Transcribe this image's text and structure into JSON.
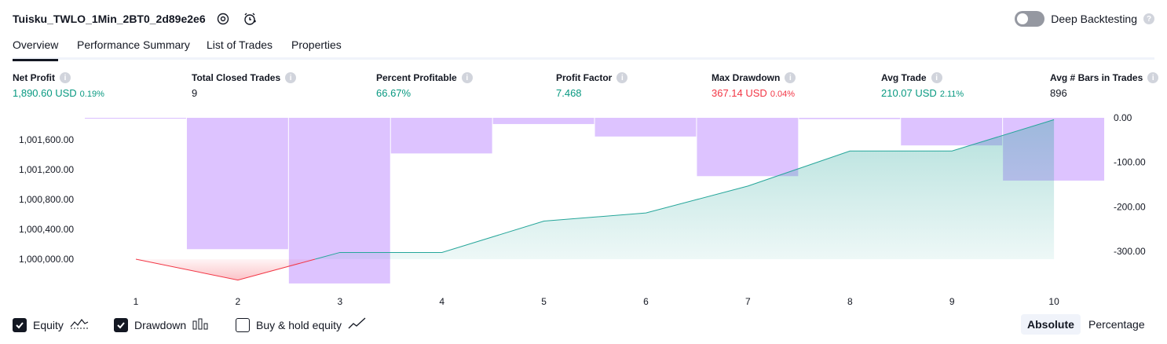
{
  "header": {
    "title": "Tuisku_TWLO_1Min_2BT0_2d89e2e6",
    "deep_backtesting_label": "Deep Backtesting",
    "help_glyph": "?"
  },
  "tabs": [
    {
      "label": "Overview",
      "active": true
    },
    {
      "label": "Performance Summary",
      "active": false
    },
    {
      "label": "List of Trades",
      "active": false
    },
    {
      "label": "Properties",
      "active": false
    }
  ],
  "stats": [
    {
      "label": "Net Profit",
      "value": "1,890.60 USD",
      "pct": "0.19%",
      "color": "green"
    },
    {
      "label": "Total Closed Trades",
      "value": "9",
      "pct": "",
      "color": "default"
    },
    {
      "label": "Percent Profitable",
      "value": "66.67%",
      "pct": "",
      "color": "green"
    },
    {
      "label": "Profit Factor",
      "value": "7.468",
      "pct": "",
      "color": "green"
    },
    {
      "label": "Max Drawdown",
      "value": "367.14 USD",
      "pct": "0.04%",
      "color": "red"
    },
    {
      "label": "Avg Trade",
      "value": "210.07 USD",
      "pct": "2.11%",
      "color": "green"
    },
    {
      "label": "Avg # Bars in Trades",
      "value": "896",
      "pct": "",
      "color": "default"
    }
  ],
  "chart_data": {
    "type": "bar+line",
    "x": [
      1,
      2,
      3,
      4,
      5,
      6,
      7,
      8,
      9,
      10
    ],
    "left_axis": {
      "ticks": [
        "1,001,600.00",
        "1,001,200.00",
        "1,000,800.00",
        "1,000,400.00",
        "1,000,000.00"
      ],
      "tick_values": [
        1001600,
        1001200,
        1000800,
        1000400,
        1000000
      ]
    },
    "right_axis": {
      "ticks": [
        "0.00",
        "-100.00",
        "-200.00",
        "-300.00"
      ],
      "tick_values": [
        0,
        -100,
        -200,
        -300
      ]
    },
    "series": [
      {
        "name": "Equity",
        "axis": "left",
        "values": [
          1000000,
          999720,
          1000090,
          1000090,
          1000510,
          1000620,
          1000980,
          1001450,
          1001450,
          1001870
        ]
      },
      {
        "name": "Drawdown",
        "axis": "right",
        "values": [
          -2,
          -295,
          -372,
          -80,
          -14,
          -42,
          -131,
          -3,
          -62,
          -141
        ]
      }
    ],
    "colors": {
      "equity_line": "#26a69a",
      "equity_fill": "#26a69a",
      "negative_line": "#f23645",
      "drawdown_bar": "#ddc3ff"
    }
  },
  "footer": {
    "legend": [
      {
        "label": "Equity",
        "checked": true,
        "icon": "equity-icon"
      },
      {
        "label": "Drawdown",
        "checked": true,
        "icon": "drawdown-bars-icon"
      },
      {
        "label": "Buy & hold equity",
        "checked": false,
        "icon": "buy-hold-line-icon"
      }
    ],
    "modes": [
      {
        "label": "Absolute",
        "active": true
      },
      {
        "label": "Percentage",
        "active": false
      }
    ]
  }
}
